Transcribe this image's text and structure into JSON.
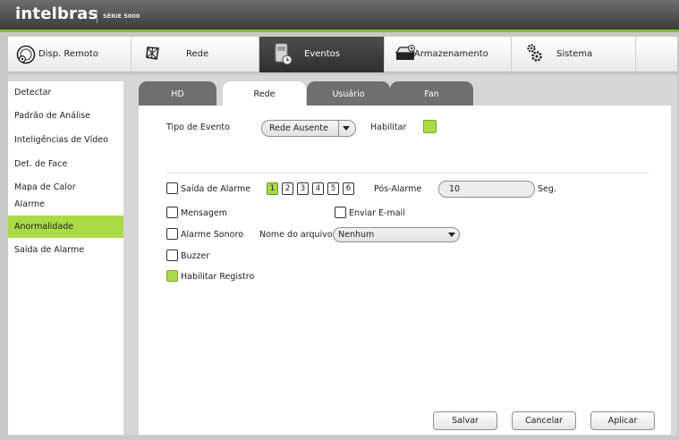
{
  "brand": {
    "name": "intelbras",
    "series": "SÉRIE 5000"
  },
  "topnav": {
    "items": [
      {
        "label": "Disp. Remoto",
        "icon": "remote-device-icon"
      },
      {
        "label": "Rede",
        "icon": "network-icon"
      },
      {
        "label": "Eventos",
        "icon": "events-icon",
        "active": true
      },
      {
        "label": "Armazenamento",
        "icon": "storage-icon"
      },
      {
        "label": "Sistema",
        "icon": "system-gear-icon"
      }
    ]
  },
  "sidebar": {
    "items": [
      {
        "label": "Detectar"
      },
      {
        "label": "Padrão de Análise"
      },
      {
        "label": "Inteligências de Vídeo"
      },
      {
        "label": "Det. de Face"
      },
      {
        "label": "Mapa de Calor"
      },
      {
        "label": "Alarme"
      },
      {
        "label": "Anormalidade",
        "active": true
      },
      {
        "label": "Saída de Alarme"
      }
    ]
  },
  "tabs": [
    {
      "label": "HD"
    },
    {
      "label": "Rede",
      "active": true
    },
    {
      "label": "Usuário"
    },
    {
      "label": "Fan"
    }
  ],
  "form": {
    "event_type_label": "Tipo de Evento",
    "event_type_value": "Rede Ausente",
    "enable_label": "Habilitar",
    "enable_checked": true,
    "alarm_output_label": "Saída de Alarme",
    "alarm_output_checked": false,
    "alarm_channels": [
      "1",
      "2",
      "3",
      "4",
      "5",
      "6"
    ],
    "alarm_channels_selected": [
      "1"
    ],
    "post_alarm_label": "Pós-Alarme",
    "post_alarm_value": "10",
    "post_alarm_unit": "Seg.",
    "message_label": "Mensagem",
    "message_checked": false,
    "send_email_label": "Enviar E-mail",
    "send_email_checked": false,
    "sound_alarm_label": "Alarme Sonoro",
    "sound_alarm_checked": false,
    "file_name_label": "Nome do arquivo",
    "file_name_value": "Nenhum",
    "buzzer_label": "Buzzer",
    "buzzer_checked": false,
    "enable_record_label": "Habilitar Registro",
    "enable_record_checked": true
  },
  "buttons": {
    "save": "Salvar",
    "cancel": "Cancelar",
    "apply": "Aplicar"
  },
  "colors": {
    "accent": "#a8dc46",
    "dark": "#3c3c3c",
    "tab": "#6f6f6f"
  }
}
